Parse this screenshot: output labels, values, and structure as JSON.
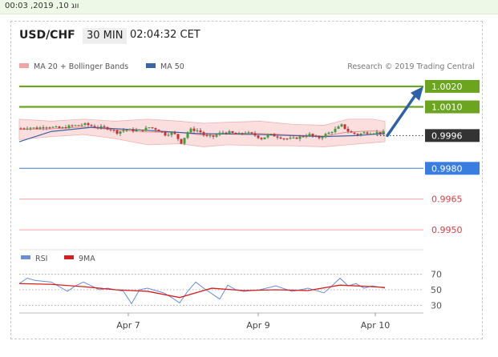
{
  "top_timestamp": "ווג 10, 2019, 00:03",
  "header": {
    "pair": "USD/CHF",
    "timeframe": "30 MIN",
    "clock": "02:04:32 CET"
  },
  "legend": {
    "bollinger": {
      "label": "MA 20 + Bollinger Bands",
      "color": "#f4a3a3"
    },
    "ma50": {
      "label": "MA 50",
      "color": "#3c63a6"
    },
    "credit": "Research © 2019 Trading Central"
  },
  "rsi_legend": {
    "rsi": {
      "label": "RSI",
      "color": "#6a8fd8"
    },
    "ma9": {
      "label": "9MA",
      "color": "#d62020"
    }
  },
  "chart_data": [
    {
      "type": "candlestick",
      "title": "USD/CHF",
      "timeframe": "30 MIN",
      "x_tick_labels": [
        "Apr 7",
        "Apr 9",
        "Apr 10"
      ],
      "ylim": [
        0.9943,
        1.0027
      ],
      "grid": false,
      "close_anchors": {
        "x": [
          0,
          10,
          20,
          30,
          40,
          50,
          60,
          70,
          80,
          90,
          100,
          110,
          120,
          130,
          140,
          150,
          160,
          170,
          180,
          190,
          200,
          210,
          220,
          225,
          230,
          240,
          250,
          260,
          270,
          280,
          290,
          300,
          310,
          320,
          330,
          340,
          350,
          360,
          370,
          380,
          390,
          400,
          410,
          420,
          430,
          440,
          456
        ],
        "y": [
          0.99995,
          1.0,
          0.99995,
          1.00005,
          1.0,
          0.99995,
          1.00005,
          1.0001,
          1.00015,
          1.00005,
          1.0,
          0.99995,
          0.99975,
          0.9999,
          0.99985,
          0.99985,
          1.0,
          0.9999,
          0.99965,
          0.99975,
          0.99925,
          0.9999,
          0.99985,
          0.99975,
          0.99955,
          0.99955,
          0.99975,
          0.99975,
          0.99965,
          0.99975,
          0.99965,
          0.99945,
          0.99965,
          0.99955,
          0.99945,
          0.99945,
          0.99955,
          0.99965,
          0.99945,
          0.99965,
          0.99985,
          1.0001,
          0.99975,
          0.99965,
          0.99975,
          0.99975,
          0.99975
        ]
      },
      "ma50_anchors": {
        "x": [
          0,
          40,
          90,
          160,
          220,
          300,
          380,
          420,
          456
        ],
        "y": [
          0.9993,
          0.9998,
          1.0,
          0.99985,
          0.9997,
          0.99965,
          0.99955,
          0.9996,
          0.9997
        ]
      },
      "bollinger_band": {
        "x": [
          0,
          40,
          80,
          120,
          160,
          200,
          230,
          260,
          300,
          340,
          380,
          410,
          440,
          456
        ],
        "upper": [
          1.0004,
          1.0003,
          1.0004,
          1.0003,
          1.0004,
          1.0003,
          1.0002,
          1.00025,
          1.0003,
          1.00015,
          1.0001,
          1.0004,
          1.0004,
          1.0003
        ],
        "lower": [
          0.9994,
          0.99955,
          0.99965,
          0.99945,
          0.99915,
          0.9992,
          0.99905,
          0.99915,
          0.9991,
          0.9991,
          0.99905,
          0.99915,
          0.99925,
          0.9993
        ]
      },
      "levels": [
        {
          "value": 1.002,
          "label": "1.0020",
          "color": "#6ba51f",
          "style": "thick"
        },
        {
          "value": 1.001,
          "label": "1.0010",
          "color": "#6ba51f",
          "style": "thick"
        },
        {
          "value": 0.9996,
          "label": "0.9996",
          "color": "#333333",
          "style": "dotted"
        },
        {
          "value": 0.998,
          "label": "0.9980",
          "color": "#3a7de0",
          "style": "solid"
        },
        {
          "value": 0.9965,
          "label": "0.9965",
          "color": "#f0a0a0",
          "style": "thin"
        },
        {
          "value": 0.995,
          "label": "0.9950",
          "color": "#f0a0a0",
          "style": "thin"
        }
      ],
      "forecast_arrow": {
        "from": 0.9996,
        "to": 1.002,
        "color": "#2d62a8"
      }
    },
    {
      "type": "line",
      "title": "RSI",
      "series": [
        {
          "name": "RSI",
          "color": "#6a8fd8",
          "x": [
            0,
            10,
            20,
            40,
            60,
            70,
            80,
            100,
            110,
            130,
            140,
            150,
            160,
            180,
            190,
            200,
            210,
            220,
            230,
            250,
            260,
            270,
            280,
            300,
            320,
            340,
            360,
            380,
            390,
            400,
            410,
            420,
            430,
            440,
            456
          ],
          "y": [
            58,
            65,
            62,
            60,
            48,
            55,
            60,
            50,
            52,
            48,
            32,
            50,
            52,
            46,
            40,
            33,
            48,
            60,
            52,
            38,
            56,
            50,
            48,
            50,
            55,
            48,
            52,
            46,
            55,
            65,
            55,
            58,
            52,
            55,
            52
          ]
        },
        {
          "name": "9MA",
          "color": "#d62020",
          "x": [
            0,
            40,
            80,
            120,
            160,
            200,
            240,
            280,
            320,
            360,
            400,
            440,
            456
          ],
          "y": [
            58,
            57,
            54,
            50,
            48,
            40,
            52,
            49,
            50,
            49,
            56,
            54,
            53
          ]
        }
      ],
      "ylim": [
        20,
        80
      ],
      "y_ticks": [
        "70",
        "50",
        "30"
      ],
      "reference_lines": [
        70,
        50,
        30
      ]
    }
  ]
}
